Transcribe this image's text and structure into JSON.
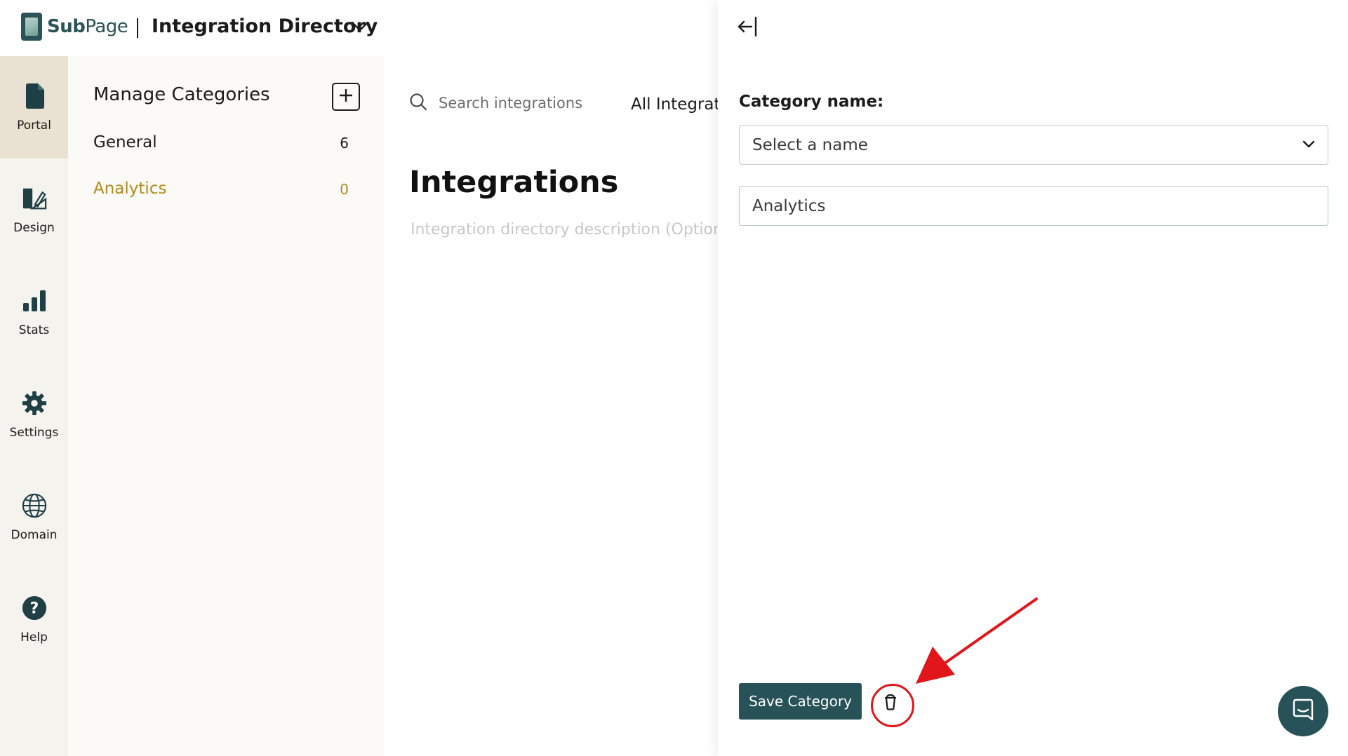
{
  "header": {
    "logo_bold": "Sub",
    "logo_light": "Page",
    "title": "Integration Directory",
    "title_chevron_icon": "chevron-down-icon"
  },
  "rail": {
    "items": [
      {
        "label": "Portal",
        "icon": "document-icon",
        "active": true
      },
      {
        "label": "Design",
        "icon": "design-icon",
        "active": false
      },
      {
        "label": "Stats",
        "icon": "bar-chart-icon",
        "active": false
      },
      {
        "label": "Settings",
        "icon": "gear-icon",
        "active": false
      },
      {
        "label": "Domain",
        "icon": "globe-icon",
        "active": false
      },
      {
        "label": "Help",
        "icon": "help-icon",
        "active": false
      }
    ]
  },
  "categories": {
    "heading": "Manage Categories",
    "add_icon": "plus-icon",
    "items": [
      {
        "name": "General",
        "count": "6",
        "selected": false
      },
      {
        "name": "Analytics",
        "count": "0",
        "selected": true
      }
    ],
    "selected_color": "#b08a20"
  },
  "main": {
    "search_placeholder": "Search integrations",
    "tab_all": "All Integrati",
    "title": "Integrations",
    "description_placeholder": "Integration directory description (Option"
  },
  "drawer": {
    "collapse_icon": "arrow-left-bar-icon",
    "field_label": "Category name:",
    "select_placeholder": "Select a name",
    "name_value": "Analytics",
    "save_label": "Save Category",
    "delete_icon": "trash-icon",
    "chat_icon": "chat-icon",
    "accent_color": "#275257",
    "annotation_color": "#e0161b"
  }
}
